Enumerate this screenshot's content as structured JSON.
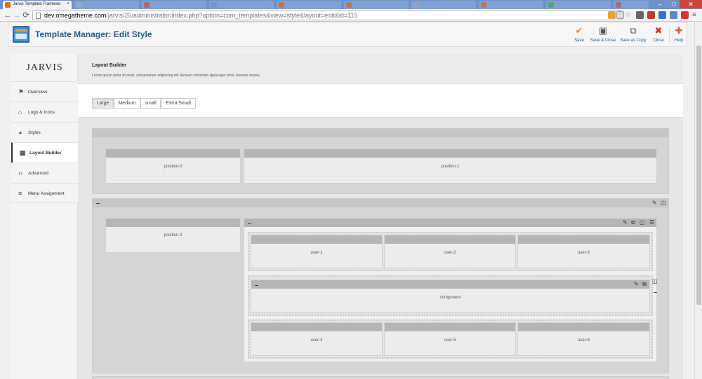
{
  "browser": {
    "active_tab_title": "Jarvis Template Framewo",
    "tab_close": "×",
    "bg_tabs": [
      "",
      "",
      "",
      "",
      "",
      "",
      "",
      "",
      ""
    ],
    "nav": {
      "back": "←",
      "forward": "→",
      "reload": "⟳"
    },
    "url_domain": "dev.omegatheme.com",
    "url_path": "/jarvis/25/administrator/index.php?option=com_templates&view=style&layout=edit&id=115",
    "window_controls": {
      "minimize": "–",
      "maximize": "□",
      "close": "✕"
    }
  },
  "toolbar": {
    "title": "Template Manager: Edit Style",
    "buttons": [
      {
        "label": "Save",
        "icon": "✔",
        "color": "#e8911f"
      },
      {
        "label": "Save & Close",
        "icon": "▣",
        "color": "#555555"
      },
      {
        "label": "Save as Copy",
        "icon": "⧉",
        "color": "#555555"
      },
      {
        "label": "Close",
        "icon": "✖",
        "color": "#d9342b"
      },
      {
        "label": "Help",
        "icon": "✚",
        "color": "#e2582a"
      }
    ]
  },
  "sidebar": {
    "brand": "JARVIS",
    "items": [
      {
        "label": "Overview",
        "icon": "⚑"
      },
      {
        "label": "Logo & Icons",
        "icon": "⌂"
      },
      {
        "label": "Styles",
        "icon": "◕"
      },
      {
        "label": "Layout Builder",
        "icon": "▦"
      },
      {
        "label": "Advanced",
        "icon": "‹›"
      },
      {
        "label": "Menu Assignment",
        "icon": "≡"
      }
    ],
    "active_item": "Layout Builder"
  },
  "layout_builder": {
    "title": "Layout Builder",
    "description": "Lorem ipsum dolor sit amet, consectetuer adipiscing elit. Aenean commodo ligula eget dolor. Aenean massa.",
    "device_tabs": [
      "Large",
      "Medium",
      "small",
      "Extra Small"
    ],
    "active_device": "Large",
    "positions": {
      "p0": "position-0",
      "p1": "position-1",
      "p2": "position-2",
      "u1": "user-1",
      "u2": "user-2",
      "u3": "user-3",
      "component": "component",
      "u4": "user-4",
      "u5": "user-5",
      "u6": "user-6"
    },
    "controls": {
      "collapse": "–",
      "edit": "✎",
      "copy": "⧉",
      "columns": "◫",
      "rows": "☰"
    }
  }
}
